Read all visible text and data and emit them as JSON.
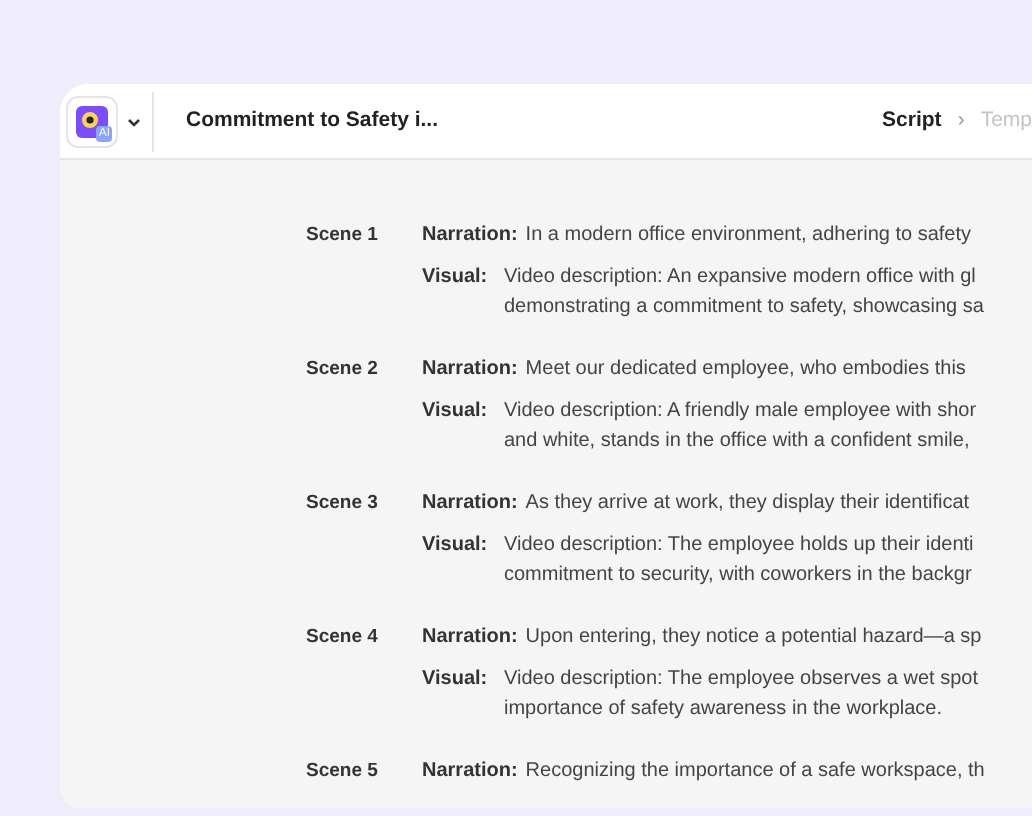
{
  "header": {
    "logo_badge": "AI",
    "title": "Commitment to Safety i...",
    "breadcrumbs": [
      {
        "label": "Script",
        "selected": true
      },
      {
        "label": "Temp",
        "selected": false
      }
    ],
    "separator": "›"
  },
  "scenes": [
    {
      "label": "Scene 1",
      "narration_label": "Narration:",
      "narration": "In a modern office environment, adhering to safety",
      "visual_label": "Visual:",
      "visual": [
        "Video description: An expansive modern office with gl",
        "demonstrating a commitment to safety, showcasing sa"
      ]
    },
    {
      "label": "Scene 2",
      "narration_label": "Narration:",
      "narration": "Meet our dedicated employee, who embodies this",
      "visual_label": "Visual:",
      "visual": [
        "Video description: A friendly male employee with shor",
        "and white, stands in the office with a confident smile,"
      ]
    },
    {
      "label": "Scene 3",
      "narration_label": "Narration:",
      "narration": "As they arrive at work, they display their identificat",
      "visual_label": "Visual:",
      "visual": [
        "Video description: The employee holds up their identi",
        "commitment to security, with coworkers in the backgr"
      ]
    },
    {
      "label": "Scene 4",
      "narration_label": "Narration:",
      "narration": "Upon entering, they notice a potential hazard—a sp",
      "visual_label": "Visual:",
      "visual": [
        "Video description: The employee observes a wet spot",
        "importance of safety awareness in the workplace."
      ]
    },
    {
      "label": "Scene 5",
      "narration_label": "Narration:",
      "narration": "Recognizing the importance of a safe workspace, th"
    }
  ]
}
